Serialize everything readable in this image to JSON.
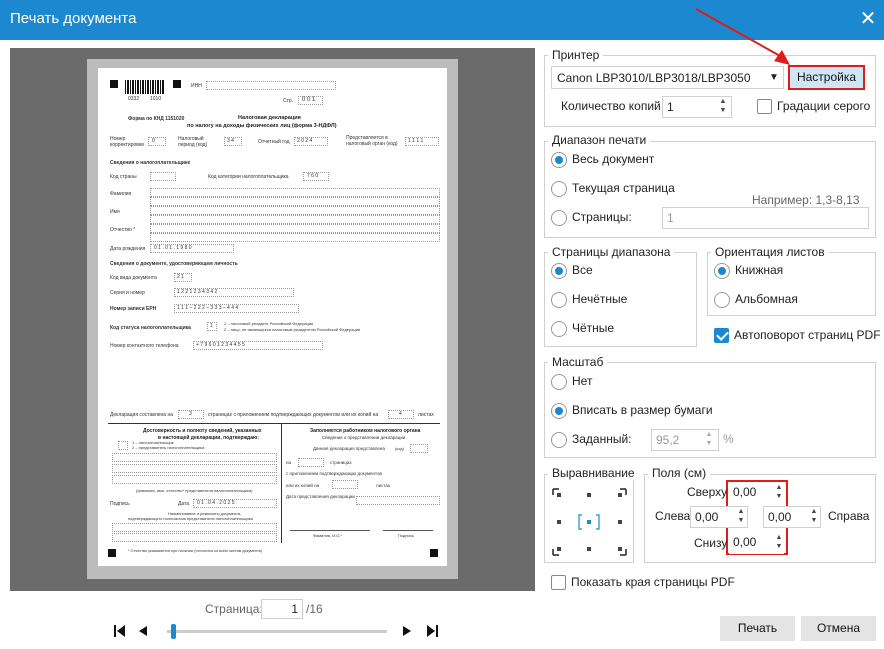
{
  "window": {
    "title": "Печать документа"
  },
  "document": {
    "inn_label": "ИНН",
    "page_label": "Стр.",
    "page_value": "0 0 1",
    "barcode_num_left": "0332",
    "barcode_num_right": "1010",
    "knd": "Форма по КНД 1151020",
    "heading1": "Налоговая декларация",
    "heading2": "по налогу на доходы физических лиц (форма 3-НДФЛ)",
    "corr_label": "Номер корректировки",
    "corr_value": "0",
    "period_label": "Налоговый период (код)",
    "period_value": "3 4",
    "year_label": "Отчетный год",
    "year_value": "2 0 2 4",
    "organ_label": "Представляется в налоговый орган (код)",
    "organ_value": "1 1 1 1",
    "section_taxpayer": "Сведения о налогоплательщике",
    "country_label": "Код страны",
    "category_label": "Код категории налогоплательщика",
    "category_value": "7 6 0",
    "surname_label": "Фамилия",
    "name_label": "Имя",
    "patronymic_label": "Отчество *",
    "birth_label": "Дата рождения",
    "birth_value": "0 1 . 0 1 . 1 9 8 0",
    "section_doc": "Сведения о документе, удостоверяющем личность",
    "doc_type_label": "Код вида документа",
    "doc_type_value": "2 1",
    "series_label": "Серия и номер",
    "series_value": "1 2 2 1   2 3 4 3 4 2",
    "erm_label": "Номер записи ЕРН",
    "erm_value": "1 1 1 – 2 2 2 – 3 3 3 – 4 4 4",
    "status_label": "Код статуса налогоплательщика",
    "status_value": "1",
    "status_note1": "1 – налоговый резидент Российской Федерации",
    "status_note2": "2 – лицо, не являющееся налоговым резидентом Российской Федерации",
    "phone_label": "Номер контактного телефона",
    "phone_value": "+ 7 9 6 0 1 2 3 4 4 5 5",
    "decl_prefix": "Декларация составлена на",
    "decl_pages": "3",
    "decl_middle": "страницах с приложением подтверждающих документов или их копий на",
    "decl_copies": "4",
    "decl_suffix": "листах",
    "confirm_title1": "Достоверность и полноту сведений, указанных",
    "confirm_title2": "в настоящей декларации, подтверждаю:",
    "confirm_opt1": "1 – налогоплательщик",
    "confirm_opt2": "2 – представитель налогоплательщика",
    "fio_note": "(фамилия, имя, отчество* представителя налогоплательщика)",
    "sign_label": "Подпись",
    "date_label": "Дата",
    "date_value": "0 1 . 0 4 . 2 0 2 5",
    "doc_name1": "Наименование и реквизиты документа,",
    "doc_name2": "подтверждающего полномочия представителя налогоплательщика",
    "tax_title": "Заполняется работником налогового органа",
    "tax_sub": "Сведения о представлении декларации",
    "tax_line1": "Данная декларация представлена",
    "tax_code": "(код)",
    "tax_on": "на",
    "tax_pages": "страницах",
    "tax_with": "с приложением подтверждающих документов",
    "tax_or": "или их копий на",
    "tax_sheets": "листах",
    "tax_date": "Дата представления декларации",
    "tax_fio": "Фамилия, И.О.*",
    "tax_sign": "Подпись",
    "footnote": "* Отчество указывается при наличии (относится ко всем листам документа)"
  },
  "nav": {
    "page_label": "Страница:",
    "page_value": "1",
    "page_total": "/16",
    "slider_fraction": 0.02
  },
  "printer": {
    "legend": "Принтер",
    "name": "Canon LBP3010/LBP3018/LBP3050",
    "settings_button": "Настройка",
    "copies_label": "Количество копий",
    "copies_value": "1",
    "grayscale_label": "Градации серого",
    "grayscale_checked": false
  },
  "range": {
    "legend": "Диапазон печати",
    "all": "Весь документ",
    "current": "Текущая страница",
    "pages": "Страницы:",
    "pages_value": "1",
    "example": "Например: 1,3-8,13",
    "selected": "all"
  },
  "subset": {
    "legend": "Страницы диапазона",
    "all": "Все",
    "odd": "Нечётные",
    "even": "Чётные",
    "selected": "all"
  },
  "orientation": {
    "legend": "Ориентация листов",
    "portrait": "Книжная",
    "landscape": "Альбомная",
    "selected": "portrait",
    "autorotate": "Автоповорот страниц PDF",
    "autorotate_checked": true
  },
  "scale": {
    "legend": "Масштаб",
    "none": "Нет",
    "fit": "Вписать в размер бумаги",
    "custom": "Заданный:",
    "custom_value": "95,2",
    "percent": "%",
    "selected": "fit"
  },
  "align": {
    "legend": "Выравнивание"
  },
  "margins": {
    "legend": "Поля (см)",
    "top_label": "Сверху",
    "top": "0,00",
    "left_label": "Слева",
    "left": "0,00",
    "right": "0,00",
    "right_label": "Справа",
    "bottom_label": "Снизу",
    "bottom": "0,00"
  },
  "show_edges": {
    "label": "Показать края страницы PDF",
    "checked": false
  },
  "buttons": {
    "print": "Печать",
    "cancel": "Отмена"
  },
  "colors": {
    "accent": "#1c88cf",
    "highlight": "#e01b1b",
    "settings_bg": "#cfe6f7"
  },
  "icons": {
    "close": "close-icon",
    "arrow": "red-arrow-annotation"
  }
}
